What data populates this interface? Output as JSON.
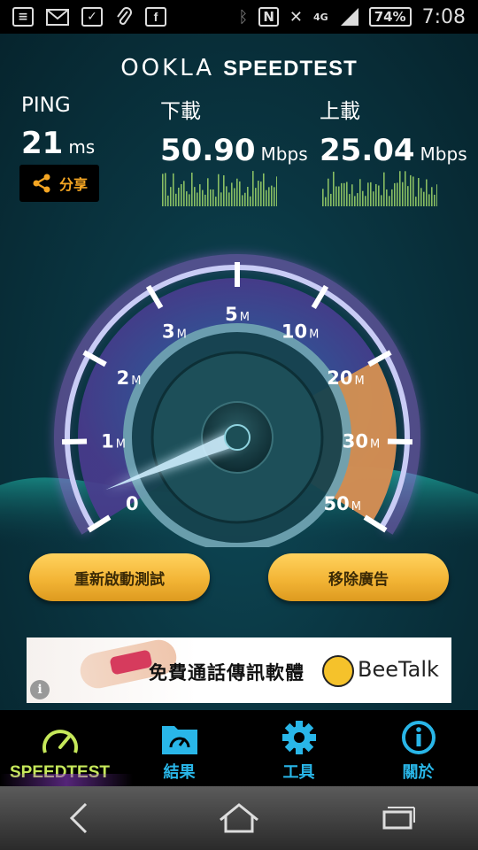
{
  "status_bar": {
    "network": "4G",
    "battery": "74%",
    "time": "7:08",
    "left_icons": [
      "message-icon",
      "gmail-icon",
      "checkbox-icon",
      "paperclip-icon",
      "facebook-icon"
    ],
    "right_icons": [
      "bluetooth-icon",
      "nfc-icon",
      "vibrate-off-icon",
      "signal-icon",
      "battery-icon"
    ]
  },
  "header": {
    "brand": "OOKLA",
    "product": "SPEEDTEST"
  },
  "metrics": {
    "ping": {
      "label": "PING",
      "value": "21",
      "unit": "ms"
    },
    "download": {
      "label": "下載",
      "value": "50.90",
      "unit": "Mbps"
    },
    "upload": {
      "label": "上載",
      "value": "25.04",
      "unit": "Mbps"
    }
  },
  "share": {
    "label": "分享"
  },
  "gauge": {
    "ticks": [
      {
        "num": "0",
        "suffix": ""
      },
      {
        "num": "1",
        "suffix": "M"
      },
      {
        "num": "2",
        "suffix": "M"
      },
      {
        "num": "3",
        "suffix": "M"
      },
      {
        "num": "5",
        "suffix": "M"
      },
      {
        "num": "10",
        "suffix": "M"
      },
      {
        "num": "20",
        "suffix": "M"
      },
      {
        "num": "30",
        "suffix": "M"
      },
      {
        "num": "50",
        "suffix": "M"
      }
    ],
    "accent": "#c9ccf5",
    "highlight": "#e69a4a"
  },
  "buttons": {
    "restart": "重新啟動測試",
    "remove_ads": "移除廣告"
  },
  "ad": {
    "text": "免費通話傳訊軟體",
    "brand": "BeeTalk",
    "info": "i"
  },
  "tabs": [
    {
      "label": "SPEEDTEST",
      "icon": "speedometer-icon",
      "active": true
    },
    {
      "label": "結果",
      "icon": "results-folder-icon",
      "active": false
    },
    {
      "label": "工具",
      "icon": "gear-icon",
      "active": false
    },
    {
      "label": "關於",
      "icon": "info-icon",
      "active": false
    }
  ]
}
